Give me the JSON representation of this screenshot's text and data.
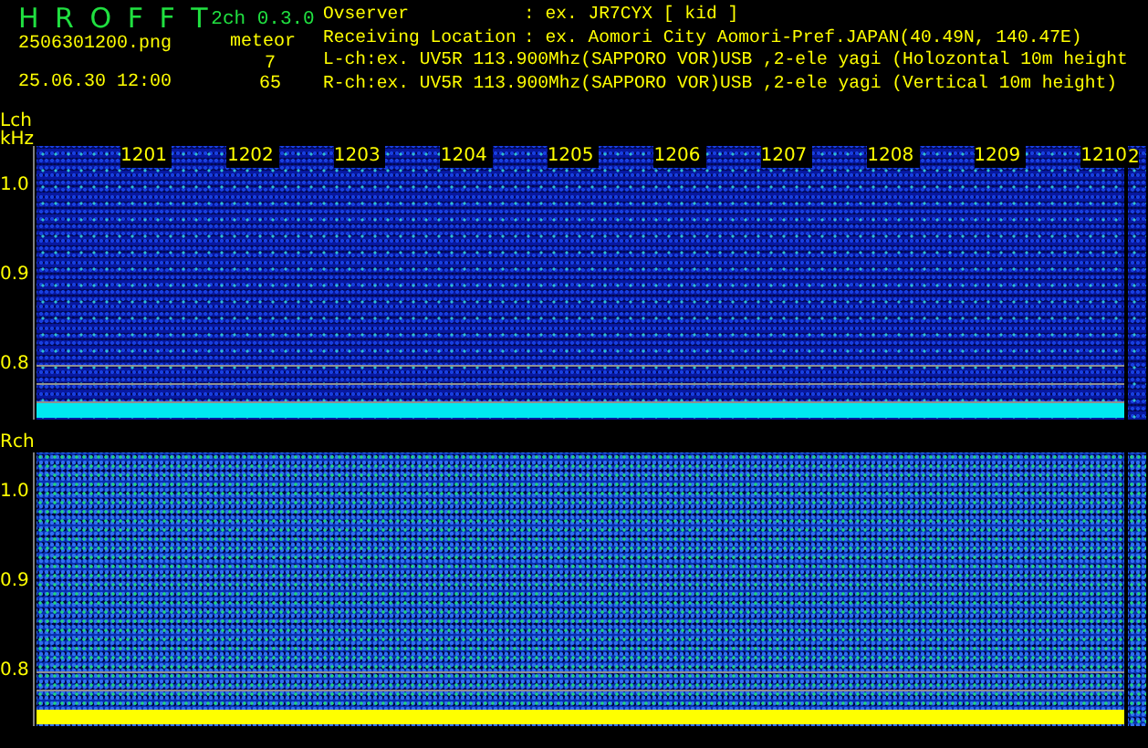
{
  "app": {
    "name": "H R O F F T",
    "version": "2ch 0.3.0"
  },
  "file": {
    "name": "2506301200.png",
    "datetime": "25.06.30 12:00"
  },
  "meteor": {
    "label": "meteor",
    "counts": [
      "7",
      "65"
    ]
  },
  "info": [
    {
      "kind": "field",
      "label": "Ovserver",
      "value": ": ex. JR7CYX [ kid ]"
    },
    {
      "kind": "field",
      "label": "Receiving Location",
      "value": ": ex. Aomori City Aomori-Pref.JAPAN(40.49N, 140.47E)"
    },
    {
      "kind": "line",
      "text": "L-ch:ex. UV5R 113.900Mhz(SAPPORO VOR)USB ,2-ele yagi (Holozontal 10m height"
    },
    {
      "kind": "line",
      "text": "R-ch:ex. UV5R 113.900Mhz(SAPPORO VOR)USB ,2-ele yagi (Vertical 10m height)"
    }
  ],
  "panels": [
    {
      "channel": "Lch",
      "unit": "kHz",
      "color": "#00e8f0",
      "time_labels": [
        "1201",
        "1202",
        "1203",
        "1204",
        "1205",
        "1206",
        "1207",
        "1208",
        "1209",
        "1210"
      ],
      "next_label": "2",
      "y_ticks": [
        "1.0",
        "0.9",
        "0.8"
      ]
    },
    {
      "channel": "Rch",
      "color": "#ffff00",
      "y_ticks": [
        "1.0",
        "0.9",
        "0.8"
      ]
    }
  ]
}
